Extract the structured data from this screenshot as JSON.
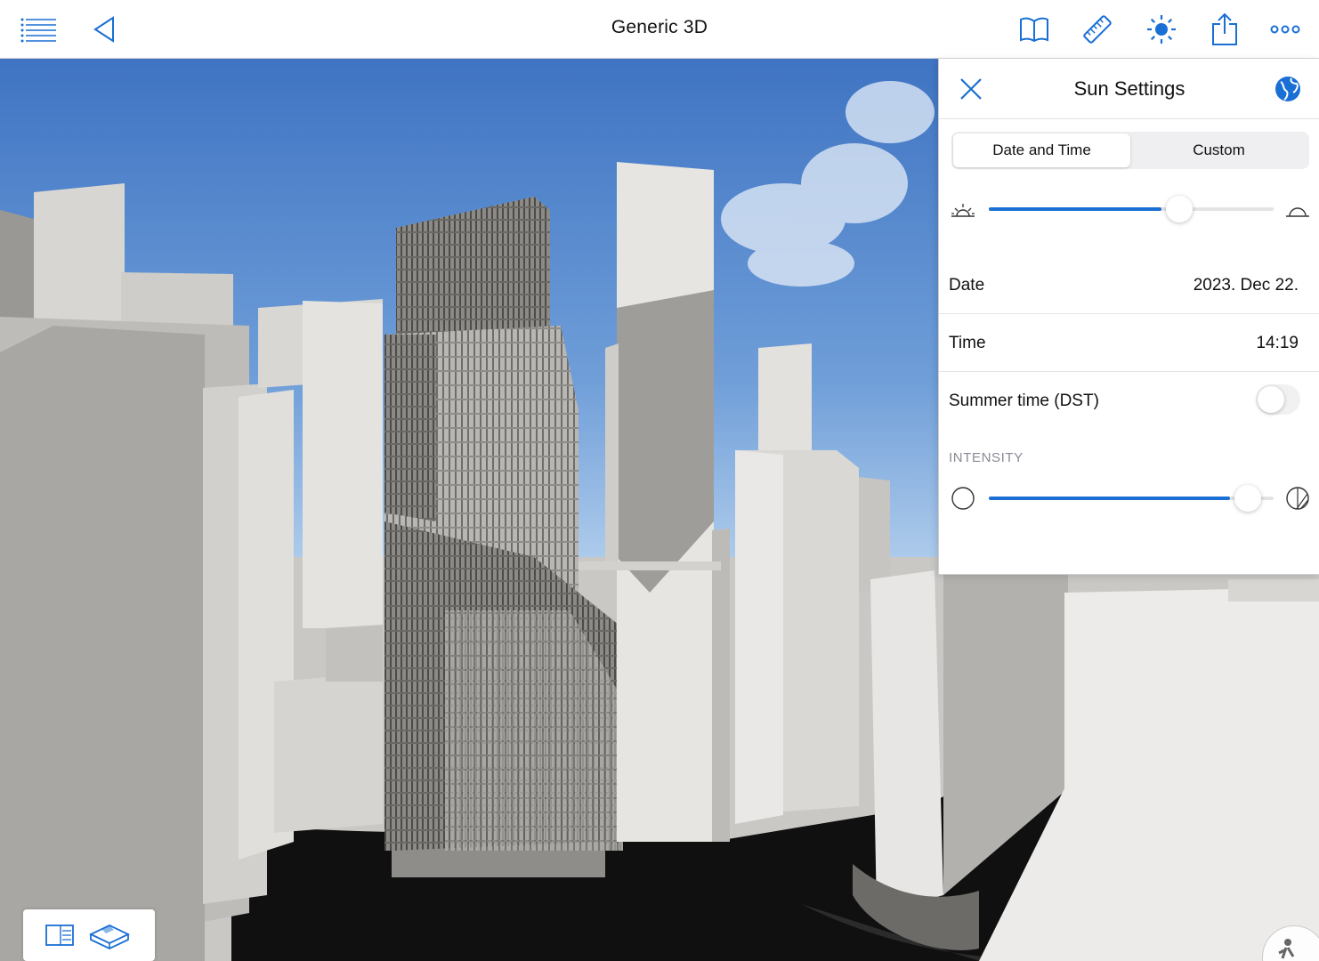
{
  "app": {
    "title": "Generic 3D"
  },
  "toolbar": {
    "icons": [
      "list-icon",
      "back-icon",
      "book-icon",
      "ruler-icon",
      "sun-icon",
      "share-icon",
      "more-icon"
    ]
  },
  "sun_panel": {
    "title": "Sun Settings",
    "tabs": [
      {
        "label": "Date and Time",
        "active": true
      },
      {
        "label": "Custom",
        "active": false
      }
    ],
    "sun_position_fraction": 0.67,
    "date_label": "Date",
    "date_value": "2023. Dec 22.",
    "time_label": "Time",
    "time_value": "14:19",
    "dst_label": "Summer time (DST)",
    "dst_enabled": false,
    "intensity_label": "INTENSITY",
    "intensity_fraction": 0.91
  },
  "colors": {
    "accent": "#1a6fd4",
    "sky_top": "#3f78c8",
    "sky_bottom": "#b8d2ee"
  }
}
